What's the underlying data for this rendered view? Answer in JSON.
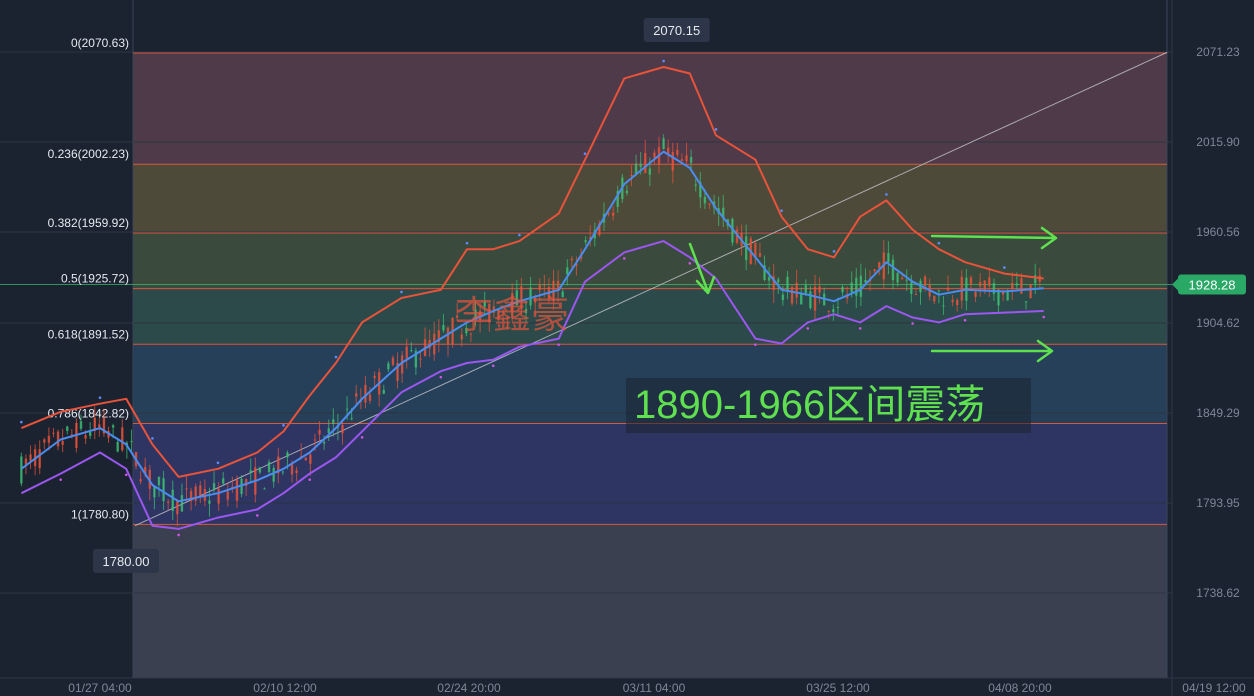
{
  "chart_data": {
    "type": "line",
    "title": "",
    "xlabel": "",
    "ylabel": "",
    "ylim": [
      1710,
      2085
    ],
    "grid": true,
    "legend": "none",
    "x_ticks": [
      "01/27 04:00",
      "02/10 12:00",
      "02/24 20:00",
      "03/11 04:00",
      "03/25 12:00",
      "04/08 20:00",
      "04/19 12:00"
    ],
    "y_ticks": [
      "2071.23",
      "2015.90",
      "1960.56",
      "1904.62",
      "1849.29",
      "1793.95",
      "1738.62"
    ],
    "current_price": {
      "label": "1928.28",
      "value": 1928.28
    },
    "high_label": {
      "label": "2070.15",
      "value": 2070.15,
      "date": "03/11"
    },
    "low_label": {
      "label": "1780.00",
      "value": 1780.0,
      "date": "01/27"
    },
    "fib_levels": [
      {
        "label": "0(2070.63)",
        "value": 2070.63
      },
      {
        "label": "0.236(2002.23)",
        "value": 2002.23
      },
      {
        "label": "0.382(1959.92)",
        "value": 1959.92
      },
      {
        "label": "0.5(1925.72)",
        "value": 1925.72
      },
      {
        "label": "0.618(1891.52)",
        "value": 1891.52
      },
      {
        "label": "0.786(1842.82)",
        "value": 1842.82
      },
      {
        "label": "1(1780.80)",
        "value": 1780.8
      }
    ],
    "annotation": "1890-1966区间震荡",
    "watermark": "李鑫豪",
    "series": [
      {
        "key": "middle",
        "color": "#4a8cf0",
        "points": [
          [
            "01/21",
            1815
          ],
          [
            "01/24",
            1833
          ],
          [
            "01/27",
            1840
          ],
          [
            "01/29",
            1830
          ],
          [
            "01/31",
            1805
          ],
          [
            "02/02",
            1795
          ],
          [
            "02/05",
            1800
          ],
          [
            "02/08",
            1808
          ],
          [
            "02/10",
            1815
          ],
          [
            "02/12",
            1825
          ],
          [
            "02/14",
            1840
          ],
          [
            "02/16",
            1858
          ],
          [
            "02/19",
            1880
          ],
          [
            "02/22",
            1895
          ],
          [
            "02/24",
            1905
          ],
          [
            "02/26",
            1912
          ],
          [
            "02/28",
            1918
          ],
          [
            "03/02",
            1925
          ],
          [
            "03/04",
            1950
          ],
          [
            "03/07",
            1990
          ],
          [
            "03/10",
            2010
          ],
          [
            "03/12",
            2000
          ],
          [
            "03/14",
            1975
          ],
          [
            "03/17",
            1945
          ],
          [
            "03/19",
            1925
          ],
          [
            "03/21",
            1922
          ],
          [
            "03/23",
            1918
          ],
          [
            "03/25",
            1925
          ],
          [
            "03/27",
            1942
          ],
          [
            "03/29",
            1930
          ],
          [
            "03/31",
            1922
          ],
          [
            "04/02",
            1925
          ],
          [
            "04/05",
            1924
          ],
          [
            "04/08",
            1926
          ]
        ]
      },
      {
        "key": "upper",
        "color": "#e8533a",
        "points": [
          [
            "01/21",
            1840
          ],
          [
            "01/24",
            1850
          ],
          [
            "01/27",
            1855
          ],
          [
            "01/29",
            1858
          ],
          [
            "01/31",
            1830
          ],
          [
            "02/02",
            1810
          ],
          [
            "02/05",
            1815
          ],
          [
            "02/08",
            1825
          ],
          [
            "02/10",
            1838
          ],
          [
            "02/12",
            1860
          ],
          [
            "02/14",
            1880
          ],
          [
            "02/16",
            1905
          ],
          [
            "02/19",
            1920
          ],
          [
            "02/22",
            1925
          ],
          [
            "02/24",
            1950
          ],
          [
            "02/26",
            1950
          ],
          [
            "02/28",
            1955
          ],
          [
            "03/02",
            1972
          ],
          [
            "03/04",
            2005
          ],
          [
            "03/07",
            2055
          ],
          [
            "03/10",
            2062
          ],
          [
            "03/12",
            2058
          ],
          [
            "03/14",
            2020
          ],
          [
            "03/17",
            2005
          ],
          [
            "03/19",
            1970
          ],
          [
            "03/21",
            1950
          ],
          [
            "03/23",
            1945
          ],
          [
            "03/25",
            1970
          ],
          [
            "03/27",
            1980
          ],
          [
            "03/29",
            1962
          ],
          [
            "03/31",
            1950
          ],
          [
            "04/02",
            1942
          ],
          [
            "04/05",
            1935
          ],
          [
            "04/08",
            1932
          ]
        ]
      },
      {
        "key": "lower",
        "color": "#9b57f0",
        "points": [
          [
            "01/21",
            1800
          ],
          [
            "01/24",
            1812
          ],
          [
            "01/27",
            1825
          ],
          [
            "01/29",
            1815
          ],
          [
            "01/31",
            1780
          ],
          [
            "02/02",
            1778
          ],
          [
            "02/05",
            1785
          ],
          [
            "02/08",
            1790
          ],
          [
            "02/10",
            1800
          ],
          [
            "02/12",
            1812
          ],
          [
            "02/14",
            1822
          ],
          [
            "02/16",
            1838
          ],
          [
            "02/19",
            1862
          ],
          [
            "02/22",
            1875
          ],
          [
            "02/24",
            1880
          ],
          [
            "02/26",
            1882
          ],
          [
            "02/28",
            1890
          ],
          [
            "03/02",
            1895
          ],
          [
            "03/04",
            1930
          ],
          [
            "03/07",
            1948
          ],
          [
            "03/10",
            1955
          ],
          [
            "03/12",
            1945
          ],
          [
            "03/14",
            1932
          ],
          [
            "03/17",
            1895
          ],
          [
            "03/19",
            1892
          ],
          [
            "03/21",
            1905
          ],
          [
            "03/23",
            1910
          ],
          [
            "03/25",
            1905
          ],
          [
            "03/27",
            1915
          ],
          [
            "03/29",
            1908
          ],
          [
            "03/31",
            1905
          ],
          [
            "04/02",
            1910
          ],
          [
            "04/05",
            1911
          ],
          [
            "04/08",
            1912
          ]
        ]
      }
    ]
  }
}
